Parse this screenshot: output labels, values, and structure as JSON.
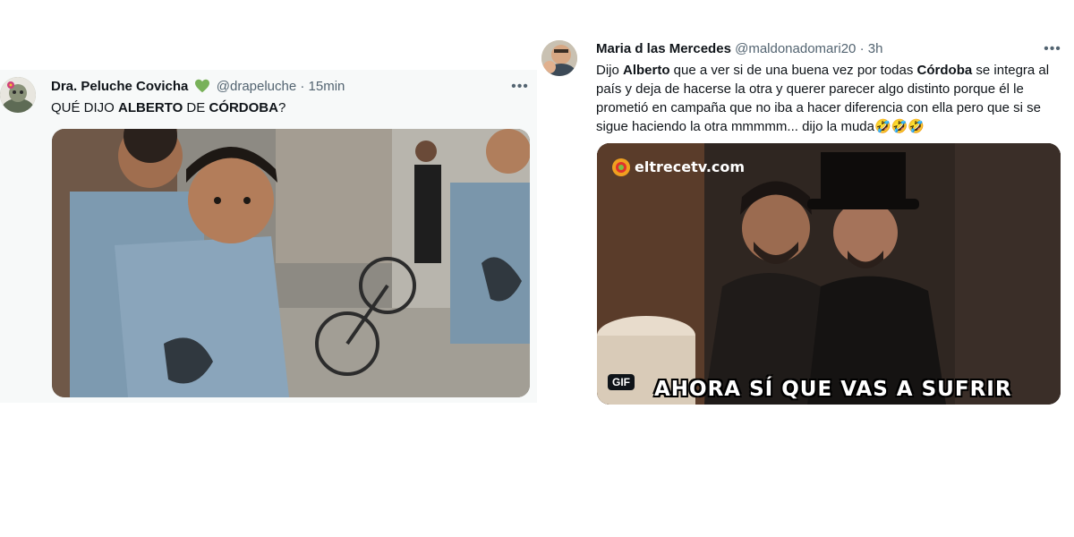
{
  "tweets": [
    {
      "display_name": "Dra. Peluche Covicha",
      "handle": "@drapeluche",
      "separator": "·",
      "time": "15min",
      "more_label": "•••",
      "text_parts": [
        "QUÉ DIJO ",
        "ALBERTO",
        " DE ",
        "CÓRDOBA",
        "?"
      ]
    },
    {
      "display_name": "Maria d las Mercedes",
      "handle": "@maldonadomari20",
      "separator": "·",
      "time": "3h",
      "more_label": "•••",
      "text_parts": [
        "Dijo ",
        "Alberto",
        " que a ver si de una buena vez por todas ",
        "Córdoba",
        " se integra al país y deja de hacerse la otra y querer parecer algo distinto porque él le prometió en campaña que no iba a hacer diferencia con ella pero que si se sigue haciendo la otra mmmmm... dijo la muda🤣🤣🤣"
      ],
      "media": {
        "watermark": "eltrecetv.com",
        "gif_badge": "GIF",
        "caption": "AHORA SÍ QUE VAS A SUFRIR"
      }
    }
  ],
  "colors": {
    "verified_heart": "#78b159",
    "secondary_text": "#536471",
    "tweet1_background": "#f7f9f9"
  }
}
